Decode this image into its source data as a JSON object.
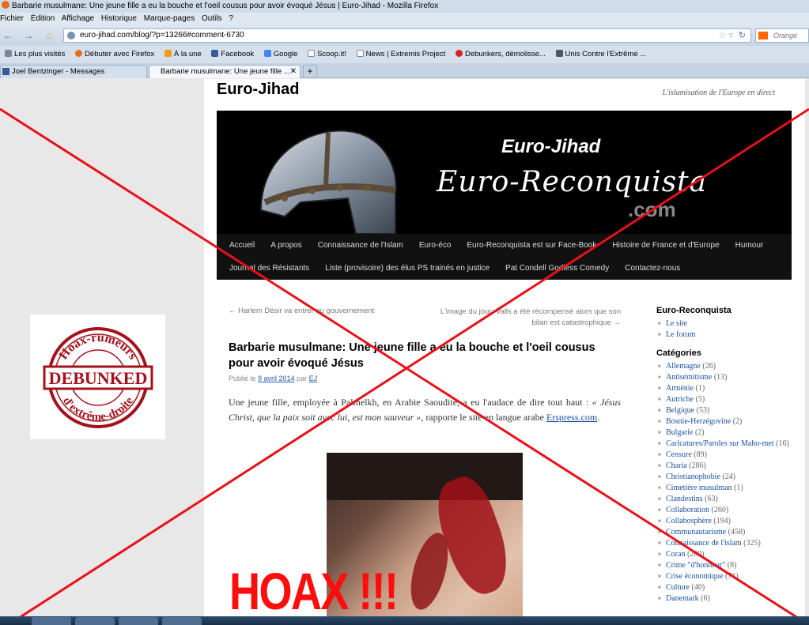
{
  "window": {
    "title": "Barbarie musulmane: Une jeune fille a eu la bouche et l'oeil cousus pour avoir évoqué Jésus | Euro-Jihad - Mozilla Firefox"
  },
  "menu": [
    "Fichier",
    "Édition",
    "Affichage",
    "Historique",
    "Marque-pages",
    "Outils",
    "?"
  ],
  "urlbar": {
    "url": "euro-jihad.com/blog/?p=13266#comment-6730"
  },
  "search": {
    "placeholder": "Orange"
  },
  "bookmarks": [
    "Les plus visités",
    "Débuter avec Firefox",
    "À la une",
    "Facebook",
    "Google",
    "Scoop.it!",
    "News | Extremis Project",
    "Debunkers, démolisse...",
    "Unis Contre l'Extrême ..."
  ],
  "tabs": [
    {
      "label": "Joel Bentzinger - Messages"
    },
    {
      "label": "Barbarie musulmane: Une jeune fille ..."
    }
  ],
  "site": {
    "title": "Euro-Jihad",
    "tagline": "L'islamisation de l'Europe en direct",
    "banner_title": "Euro-Jihad",
    "banner_script": "Euro-Reconquista",
    "banner_com": ".com",
    "nav": [
      "Accueil",
      "A propos",
      "Connaissance de l'Islam",
      "Euro-éco",
      "Euro-Reconquista est sur Face-Book",
      "Histoire de France et d'Europe",
      "Humour",
      "Journal des Résistants",
      "Liste (provisoire) des élus PS trainés en justice",
      "Pat Condell Godless Comedy",
      "Contactez-nous"
    ]
  },
  "post": {
    "prev": "← Harlem Désir va entrer au gouvernement",
    "next": "L'image du jour: Valls a été récompensé alors que son bilan est catastrophique →",
    "title": "Barbarie musulmane: Une jeune fille a eu la bouche et l'oeil cousus pour avoir évoqué Jésus",
    "meta_prefix": "Publié le",
    "date": "9 avril 2014",
    "meta_by": "par",
    "author": "EJ",
    "body_1": "Une jeune fille, employée à Palmelkh, en Arabie Saoudite, a eu l'audace de dire tout haut : ",
    "body_quote": "« Jésus Christ, que la paix soit avec lui, est mon sauveur »",
    "body_2": ", rapporte le site en langue arabe ",
    "body_link": "Erspress.com",
    "body_3": "."
  },
  "sidebar": {
    "heading1": "Euro-Reconquista",
    "links": [
      "Le site",
      "Le forum"
    ],
    "heading2": "Catégories",
    "categories": [
      {
        "name": "Allemagne",
        "count": "(26)"
      },
      {
        "name": "Antisémitisme",
        "count": "(13)"
      },
      {
        "name": "Arménie",
        "count": "(1)"
      },
      {
        "name": "Autriche",
        "count": "(5)"
      },
      {
        "name": "Belgique",
        "count": "(53)"
      },
      {
        "name": "Bosnie-Herzégovine",
        "count": "(2)"
      },
      {
        "name": "Bulgarie",
        "count": "(2)"
      },
      {
        "name": "Caricatures/Paroles sur Maho-met",
        "count": "(16)"
      },
      {
        "name": "Censure",
        "count": "(89)"
      },
      {
        "name": "Charia",
        "count": "(286)"
      },
      {
        "name": "Christianophobie",
        "count": "(24)"
      },
      {
        "name": "Cimetière musulman",
        "count": "(1)"
      },
      {
        "name": "Clandestins",
        "count": "(63)"
      },
      {
        "name": "Collaboration",
        "count": "(260)"
      },
      {
        "name": "Collabosphère",
        "count": "(194)"
      },
      {
        "name": "Communautarisme",
        "count": "(458)"
      },
      {
        "name": "Connaissance de l'islam",
        "count": "(325)"
      },
      {
        "name": "Coran",
        "count": "(200)"
      },
      {
        "name": "Crime \"d'honneur\"",
        "count": "(8)"
      },
      {
        "name": "Crise économique",
        "count": "(71)"
      },
      {
        "name": "Culture",
        "count": "(40)"
      },
      {
        "name": "Danemark",
        "count": "(6)"
      }
    ]
  },
  "stamp": {
    "top_text": "Hoax-rumeurs",
    "center_text": "DEBUNKED",
    "bottom_text": "d'extrême-droite"
  },
  "overlay": {
    "hoax_text": "HOAX !!!"
  },
  "colors": {
    "stamp_red": "#a3121c",
    "overlay_red": "#ff0c0c",
    "link_blue": "#1a4fa0"
  }
}
